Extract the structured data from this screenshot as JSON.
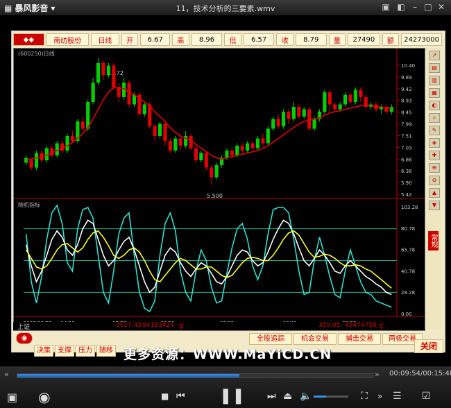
{
  "app": {
    "name": "暴风影音",
    "window_title": "11，技术分析的三要素.wmv"
  },
  "stock_toolbar": {
    "stock_name": "南纺股份",
    "period": "日线",
    "open_label": "开",
    "open_value": "6.67",
    "high_label": "高",
    "high_value": "8.96",
    "low_label": "低",
    "low_value": "6.57",
    "close_label": "收",
    "close_value": "8.79",
    "volume_label": "量",
    "volume_value": "27490",
    "amount_label": "额",
    "amount_value": "24273000"
  },
  "chart_header": {
    "code": "(600250)日线",
    "indicator": "随机指标"
  },
  "annotations": {
    "high": "13.72",
    "low": "5.500"
  },
  "price_axis": [
    "10.40",
    "9.89",
    "9.42",
    "8.93",
    "8.45",
    "7.99",
    "7.51",
    "7.03",
    "6.86",
    "6.38",
    "5.90",
    "5.42"
  ],
  "osc_axis": [
    "103.28",
    "80.78",
    "65.78",
    "40.78",
    "28.28",
    "0.00"
  ],
  "dates": [
    "2007/03/23",
    "04/09",
    "05/08",
    "06/01",
    "07/02",
    "08/01",
    "08/03"
  ],
  "status": {
    "left_label": "上证",
    "v1": "3017.45",
    "v2": "94183424",
    "unit": "手",
    "v3": "350.05",
    "v4": "45474758",
    "unit2": "手"
  },
  "trade_buttons": [
    "全股追踪",
    "机会交易",
    "捕击交易",
    "两极交易"
  ],
  "left_tabs": [
    "决策",
    "支撑",
    "压力",
    "随移"
  ],
  "close_label": "关闭",
  "side_label": "常规",
  "watermark": "更多资源：WWW.MaYiCD.CN",
  "player": {
    "time": "00:09:54/00:15:48",
    "progress": 0.625
  },
  "chart_data": {
    "type": "candlestick",
    "candles": [
      [
        6.5,
        6.7,
        6.4,
        6.8
      ],
      [
        6.6,
        6.3,
        6.2,
        6.7
      ],
      [
        6.3,
        6.9,
        6.2,
        7.0
      ],
      [
        6.9,
        6.6,
        6.5,
        7.0
      ],
      [
        6.6,
        7.1,
        6.5,
        7.2
      ],
      [
        7.1,
        6.8,
        6.7,
        7.2
      ],
      [
        6.8,
        7.3,
        6.7,
        7.4
      ],
      [
        7.3,
        7.0,
        6.9,
        7.4
      ],
      [
        7.0,
        7.6,
        6.9,
        7.7
      ],
      [
        7.6,
        7.4,
        7.3,
        7.8
      ],
      [
        7.4,
        8.2,
        7.3,
        8.3
      ],
      [
        8.2,
        7.9,
        7.8,
        8.4
      ],
      [
        7.9,
        9.0,
        7.8,
        9.1
      ],
      [
        9.0,
        9.8,
        8.9,
        10.0
      ],
      [
        9.8,
        10.6,
        9.7,
        10.8
      ],
      [
        10.6,
        10.1,
        9.9,
        10.7
      ],
      [
        10.1,
        10.5,
        10.0,
        10.6
      ],
      [
        10.5,
        9.6,
        9.5,
        10.6
      ],
      [
        9.6,
        9.2,
        9.0,
        9.8
      ],
      [
        9.2,
        9.8,
        9.1,
        10.0
      ],
      [
        9.8,
        8.9,
        8.8,
        9.9
      ],
      [
        8.9,
        9.3,
        8.8,
        9.4
      ],
      [
        9.3,
        8.5,
        8.4,
        9.4
      ],
      [
        8.5,
        8.9,
        8.4,
        9.0
      ],
      [
        8.9,
        8.0,
        7.9,
        9.0
      ],
      [
        8.0,
        7.6,
        7.4,
        8.1
      ],
      [
        7.6,
        8.1,
        7.5,
        8.2
      ],
      [
        8.1,
        7.4,
        7.2,
        8.2
      ],
      [
        7.4,
        7.0,
        6.9,
        7.5
      ],
      [
        7.0,
        7.5,
        6.9,
        7.6
      ],
      [
        7.5,
        7.2,
        7.0,
        7.6
      ],
      [
        7.2,
        7.6,
        7.1,
        7.8
      ],
      [
        7.6,
        7.1,
        7.0,
        7.7
      ],
      [
        7.1,
        6.6,
        6.5,
        7.2
      ],
      [
        6.6,
        6.9,
        6.5,
        7.0
      ],
      [
        6.9,
        6.3,
        6.2,
        7.0
      ],
      [
        6.3,
        5.9,
        5.6,
        6.4
      ],
      [
        5.9,
        6.4,
        5.8,
        6.5
      ],
      [
        6.4,
        6.7,
        6.3,
        6.8
      ],
      [
        6.7,
        7.0,
        6.6,
        7.1
      ],
      [
        7.0,
        6.8,
        6.7,
        7.1
      ],
      [
        6.8,
        7.2,
        6.7,
        7.3
      ],
      [
        7.2,
        7.0,
        6.9,
        7.3
      ],
      [
        7.0,
        7.3,
        6.9,
        7.4
      ],
      [
        7.3,
        7.1,
        7.0,
        7.4
      ],
      [
        7.1,
        7.5,
        7.0,
        7.6
      ],
      [
        7.5,
        7.3,
        7.2,
        7.7
      ],
      [
        7.3,
        7.9,
        7.2,
        8.0
      ],
      [
        7.9,
        8.3,
        7.8,
        8.4
      ],
      [
        8.3,
        8.0,
        7.9,
        8.5
      ],
      [
        8.0,
        8.6,
        7.9,
        8.7
      ],
      [
        8.6,
        8.3,
        8.1,
        8.7
      ],
      [
        8.3,
        8.8,
        8.2,
        9.0
      ],
      [
        8.8,
        8.4,
        8.3,
        8.9
      ],
      [
        8.4,
        8.7,
        8.3,
        8.8
      ],
      [
        8.7,
        7.9,
        7.8,
        8.8
      ],
      [
        7.9,
        8.3,
        7.8,
        8.4
      ],
      [
        8.3,
        8.6,
        8.2,
        8.7
      ],
      [
        8.6,
        9.4,
        8.5,
        9.5
      ],
      [
        9.4,
        8.9,
        8.6,
        9.5
      ],
      [
        8.9,
        8.7,
        8.6,
        9.0
      ],
      [
        8.7,
        8.9,
        8.6,
        9.0
      ],
      [
        8.9,
        9.3,
        8.8,
        9.4
      ],
      [
        9.3,
        9.0,
        8.9,
        9.4
      ],
      [
        9.0,
        9.5,
        8.9,
        9.6
      ],
      [
        9.5,
        9.2,
        9.0,
        9.6
      ],
      [
        9.2,
        8.8,
        8.7,
        9.3
      ],
      [
        8.8,
        8.9,
        8.7,
        9.0
      ],
      [
        8.9,
        8.7,
        8.6,
        9.0
      ],
      [
        8.7,
        8.8,
        8.5,
        8.9
      ],
      [
        8.8,
        8.6,
        8.5,
        8.9
      ],
      [
        8.6,
        8.8,
        8.5,
        8.9
      ]
    ],
    "ma": [
      6.6,
      6.65,
      6.7,
      6.75,
      6.8,
      6.9,
      7.0,
      7.1,
      7.2,
      7.35,
      7.5,
      7.7,
      7.95,
      8.3,
      8.7,
      9.1,
      9.4,
      9.6,
      9.6,
      9.55,
      9.4,
      9.3,
      9.15,
      9.0,
      8.85,
      8.6,
      8.4,
      8.2,
      7.95,
      7.75,
      7.6,
      7.5,
      7.4,
      7.25,
      7.1,
      6.95,
      6.8,
      6.7,
      6.65,
      6.7,
      6.75,
      6.8,
      6.85,
      6.9,
      6.95,
      7.0,
      7.1,
      7.2,
      7.35,
      7.5,
      7.65,
      7.8,
      7.95,
      8.1,
      8.2,
      8.25,
      8.3,
      8.35,
      8.45,
      8.55,
      8.6,
      8.65,
      8.7,
      8.75,
      8.8,
      8.85,
      8.85,
      8.85,
      8.8,
      8.8,
      8.75,
      8.75
    ],
    "k": [
      65,
      45,
      30,
      40,
      55,
      70,
      78,
      72,
      60,
      55,
      65,
      80,
      88,
      85,
      70,
      55,
      45,
      50,
      60,
      68,
      72,
      60,
      45,
      30,
      20,
      25,
      40,
      55,
      62,
      58,
      48,
      40,
      35,
      42,
      48,
      45,
      38,
      30,
      28,
      35,
      45,
      55,
      60,
      58,
      50,
      45,
      48,
      58,
      70,
      80,
      88,
      85,
      75,
      62,
      50,
      45,
      52,
      60,
      55,
      48,
      40,
      38,
      45,
      50,
      45,
      40,
      35,
      32,
      28,
      25,
      20,
      18
    ],
    "d": [
      60,
      52,
      44,
      42,
      45,
      52,
      60,
      65,
      66,
      62,
      58,
      62,
      70,
      76,
      78,
      72,
      64,
      55,
      52,
      55,
      60,
      62,
      58,
      50,
      40,
      32,
      30,
      36,
      42,
      48,
      52,
      50,
      46,
      42,
      42,
      44,
      44,
      40,
      36,
      34,
      36,
      42,
      48,
      52,
      53,
      52,
      50,
      50,
      55,
      62,
      70,
      76,
      78,
      74,
      66,
      58,
      53,
      54,
      56,
      55,
      52,
      48,
      45,
      45,
      46,
      45,
      42,
      40,
      36,
      32,
      28,
      24
    ],
    "j": [
      75,
      30,
      10,
      35,
      70,
      95,
      102,
      85,
      48,
      40,
      80,
      98,
      100,
      90,
      55,
      20,
      10,
      40,
      75,
      90,
      95,
      55,
      20,
      5,
      2,
      12,
      55,
      85,
      95,
      78,
      40,
      20,
      12,
      40,
      60,
      50,
      25,
      10,
      12,
      38,
      62,
      80,
      85,
      70,
      45,
      32,
      45,
      75,
      98,
      100,
      100,
      95,
      70,
      40,
      18,
      20,
      50,
      72,
      55,
      35,
      18,
      15,
      40,
      60,
      45,
      30,
      20,
      18,
      12,
      10,
      8,
      6
    ],
    "price_ylim": [
      5.2,
      10.8
    ],
    "osc_ylim": [
      0,
      103.28
    ]
  },
  "colors": {
    "up": "#00d000",
    "down": "#e00000",
    "ma": "#e00000",
    "k": "#ffffff",
    "d": "#ffff30",
    "j": "#30e0d0",
    "grid": "#1faa88"
  }
}
